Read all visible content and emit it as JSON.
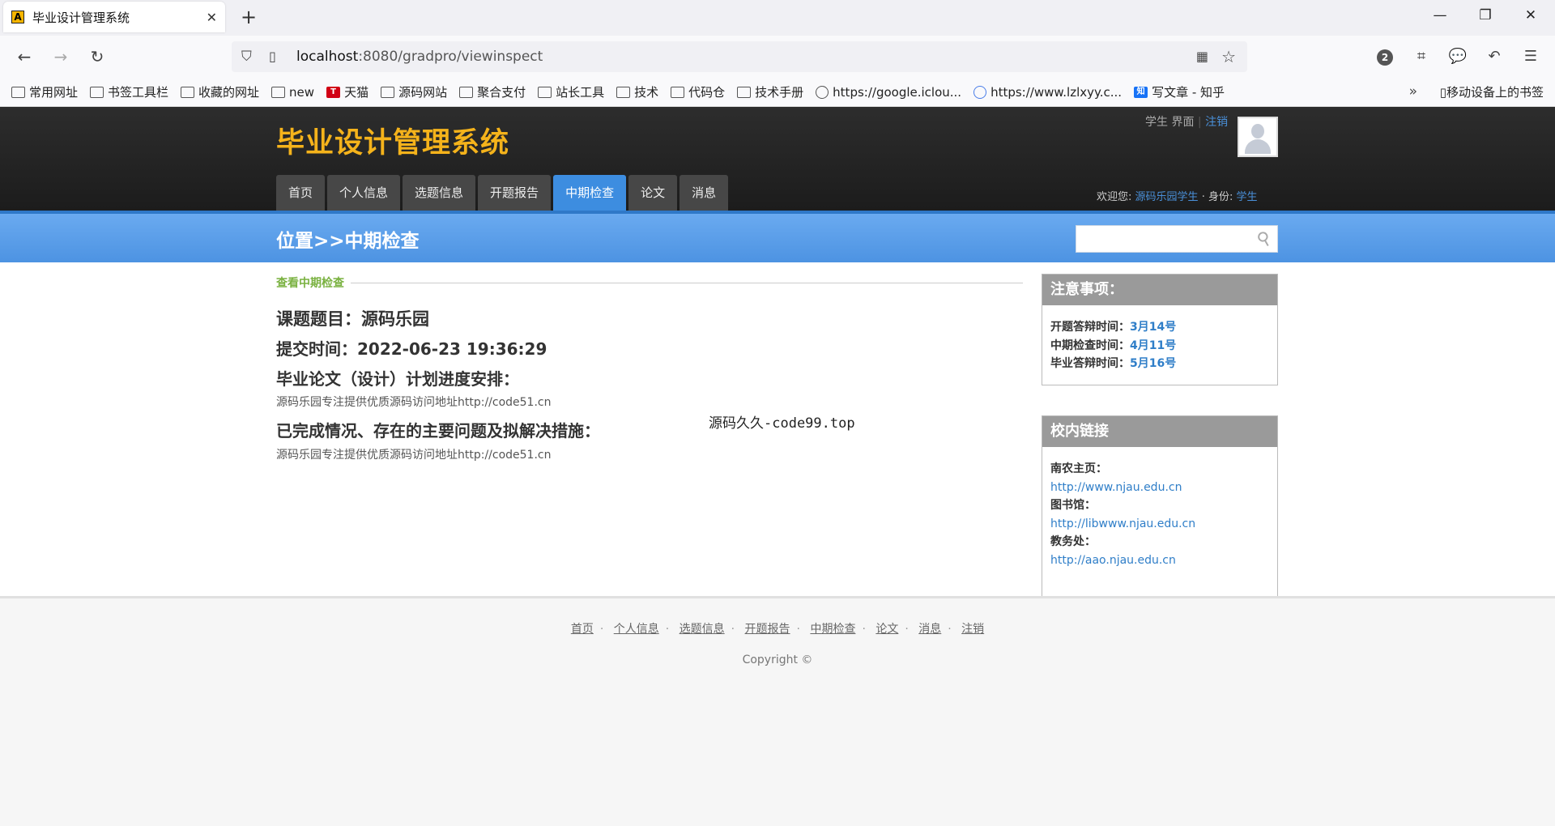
{
  "browser": {
    "tab_title": "毕业设计管理系统",
    "tab_favicon": "A",
    "url_host": "localhost",
    "url_rest": ":8080/gradpro/viewinspect",
    "badge_count": "2",
    "bookmarks": [
      "常用网址",
      "书签工具栏",
      "收藏的网址",
      "new",
      "天猫",
      "源码网站",
      "聚合支付",
      "站长工具",
      "技术",
      "代码仓",
      "技术手册",
      "https://google.iclou...",
      "https://www.lzlxyy.c...",
      "写文章 - 知乎"
    ],
    "mobile_bookmarks": "移动设备上的书签"
  },
  "site": {
    "logo": "毕业设计管理系统",
    "user_role": "学生 界面",
    "sep": "|",
    "logout": "注销",
    "menu": [
      "首页",
      "个人信息",
      "选题信息",
      "开题报告",
      "中期检查",
      "论文",
      "消息"
    ],
    "active_menu_index": 4,
    "welcome_label": "欢迎您:",
    "welcome_name": "源码乐园学生",
    "identity_label": "· 身份:",
    "identity": "学生"
  },
  "location": {
    "title": "位置>>中期检查",
    "search_placeholder": ""
  },
  "content": {
    "section_title": "查看中期检查",
    "topic": "课题题目：源码乐园",
    "submit_time": "提交时间：2022-06-23 19:36:29",
    "plan_heading": "毕业论文（设计）计划进度安排：",
    "plan_text": "源码乐园专注提供优质源码访问地址http://code51.cn",
    "progress_heading": "已完成情况、存在的主要问题及拟解决措施：",
    "progress_text": "源码乐园专注提供优质源码访问地址http://code51.cn",
    "watermark": "源码久久-code99.top"
  },
  "notice": {
    "title": "注意事项：",
    "rows": [
      {
        "label": "开题答辩时间：",
        "value": "3月14号"
      },
      {
        "label": "中期检查时间：",
        "value": "4月11号"
      },
      {
        "label": "毕业答辩时间：",
        "value": "5月16号"
      }
    ]
  },
  "links": {
    "title": "校内链接",
    "items": [
      {
        "label": "南农主页：",
        "url": "http://www.njau.edu.cn"
      },
      {
        "label": "图书馆：",
        "url": "http://libwww.njau.edu.cn"
      },
      {
        "label": "教务处：",
        "url": "http://aao.njau.edu.cn"
      }
    ]
  },
  "footer": {
    "links": [
      "首页",
      "个人信息",
      "选题信息",
      "开题报告",
      "中期检查",
      "论文",
      "消息",
      "注销"
    ],
    "copyright": "Copyright ©"
  },
  "colors": {
    "logo": "#f5b31b",
    "active_tab": "#3d8de0",
    "location_bar": "#5b9de8",
    "section_green": "#7ab241",
    "link_blue": "#2f7ec8"
  }
}
